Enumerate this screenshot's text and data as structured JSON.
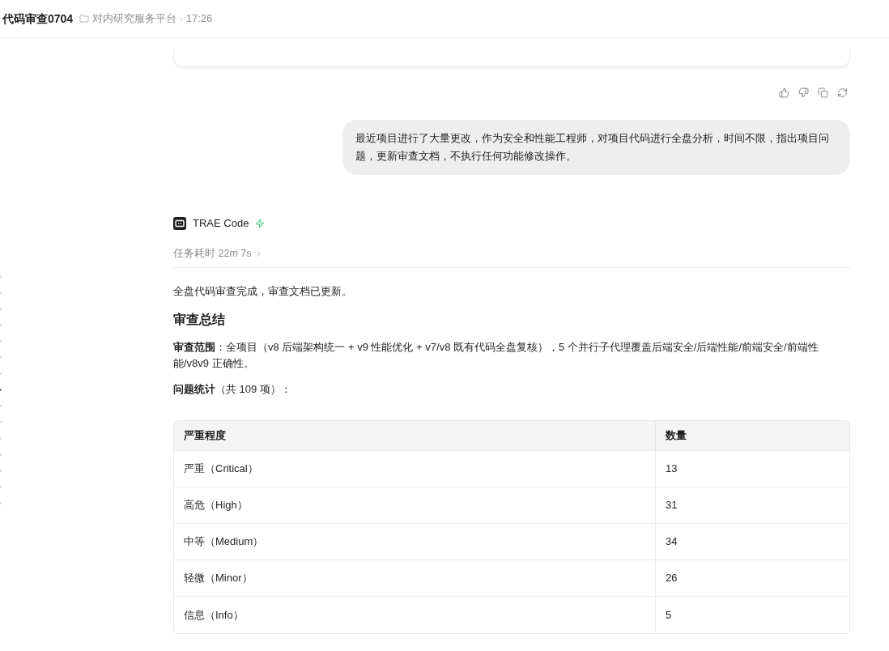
{
  "header": {
    "title": "代码审查0704",
    "subtitle": "对内研究服务平台 · 17:26"
  },
  "user_message": {
    "text": "最近项目进行了大量更改，作为安全和性能工程师，对项目代码进行全盘分析，时间不限，指出项目问题，更新审查文档，不执行任何功能修改操作。"
  },
  "assistant": {
    "name": "TRAE Code",
    "duration": "任务耗时 22m 7s",
    "intro": "全盘代码审查完成，审查文档已更新。",
    "heading": "审查总结",
    "paragraphs": [
      "**审查范围**：全项目（v8 后端架构统一 + v9 性能优化 + v7/v8 既有代码全盘复核），5 个并行子代理覆盖后端安全/后端性能/前端安全/前端性能/v8v9 正确性。",
      "**问题统计**（共 109 项）："
    ],
    "table": {
      "columns": [
        "严重程度",
        "数量"
      ],
      "rows": [
        [
          "严重（Critical）",
          "13"
        ],
        [
          "高危（High）",
          "31"
        ],
        [
          "中等（Medium）",
          "34"
        ],
        [
          "轻微（Minor）",
          "26"
        ],
        [
          "信息（Info）",
          "5"
        ]
      ]
    }
  }
}
